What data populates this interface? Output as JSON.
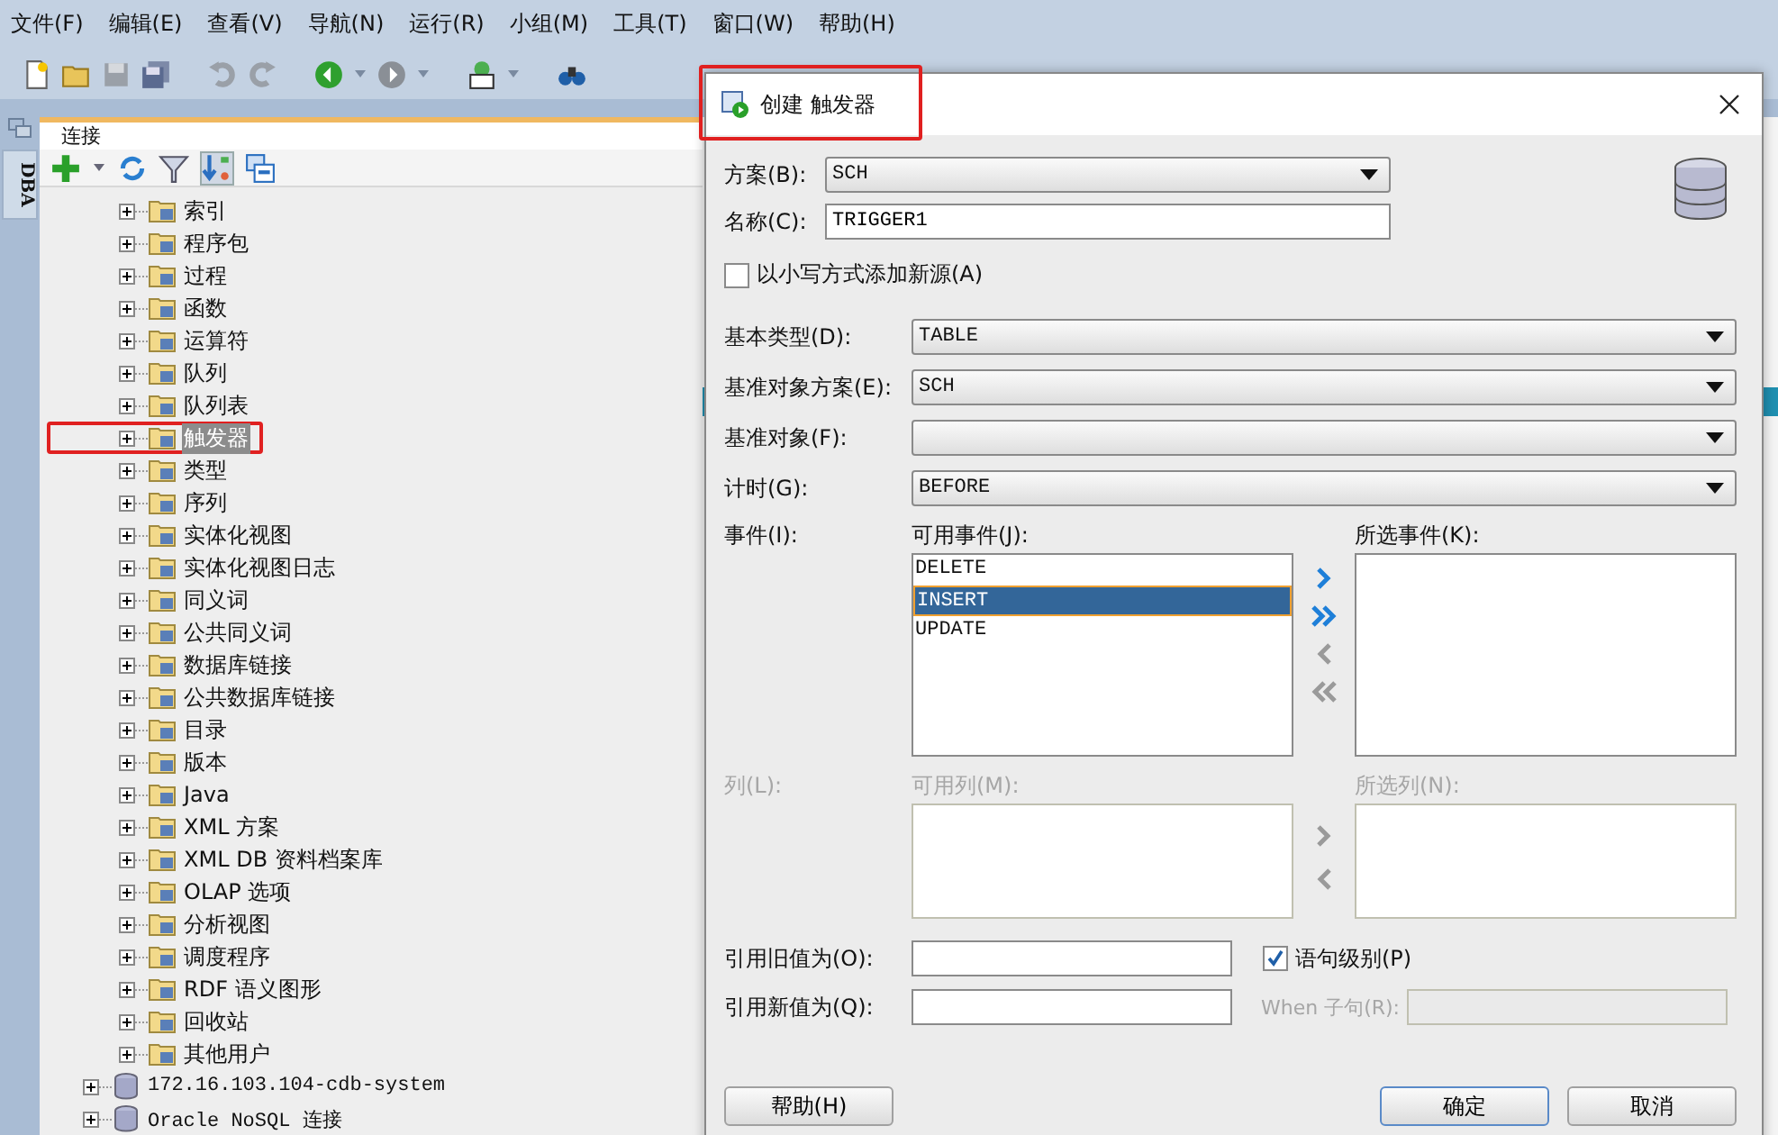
{
  "menu": [
    "文件(F)",
    "编辑(E)",
    "查看(V)",
    "导航(N)",
    "运行(R)",
    "小组(M)",
    "工具(T)",
    "窗口(W)",
    "帮助(H)"
  ],
  "side_tab": {
    "label": "DBA"
  },
  "connections_panel": {
    "title": "连接",
    "tree": [
      {
        "label": "索引",
        "selected": false
      },
      {
        "label": "程序包",
        "selected": false
      },
      {
        "label": "过程",
        "selected": false
      },
      {
        "label": "函数",
        "selected": false
      },
      {
        "label": "运算符",
        "selected": false
      },
      {
        "label": "队列",
        "selected": false
      },
      {
        "label": "队列表",
        "selected": false
      },
      {
        "label": "触发器",
        "selected": true
      },
      {
        "label": "类型",
        "selected": false
      },
      {
        "label": "序列",
        "selected": false
      },
      {
        "label": "实体化视图",
        "selected": false
      },
      {
        "label": "实体化视图日志",
        "selected": false
      },
      {
        "label": "同义词",
        "selected": false
      },
      {
        "label": "公共同义词",
        "selected": false
      },
      {
        "label": "数据库链接",
        "selected": false
      },
      {
        "label": "公共数据库链接",
        "selected": false
      },
      {
        "label": "目录",
        "selected": false
      },
      {
        "label": "版本",
        "selected": false
      },
      {
        "label": "Java",
        "selected": false
      },
      {
        "label": "XML 方案",
        "selected": false
      },
      {
        "label": "XML DB 资料档案库",
        "selected": false
      },
      {
        "label": "OLAP 选项",
        "selected": false
      },
      {
        "label": "分析视图",
        "selected": false
      },
      {
        "label": "调度程序",
        "selected": false
      },
      {
        "label": "RDF 语义图形",
        "selected": false
      },
      {
        "label": "回收站",
        "selected": false
      },
      {
        "label": "其他用户",
        "selected": false
      }
    ],
    "connections": [
      {
        "label": "172.16.103.104-cdb-system"
      },
      {
        "label": "Oracle NoSQL 连接"
      }
    ]
  },
  "dialog": {
    "title": "创建 触发器",
    "schema": {
      "label": "方案(B):",
      "value": "SCH"
    },
    "name": {
      "label": "名称(C):",
      "value": "TRIGGER1"
    },
    "lowercase": {
      "label": "以小写方式添加新源(A)",
      "checked": false
    },
    "base_rows": [
      {
        "label": "基本类型(D):",
        "value": "TABLE"
      },
      {
        "label": "基准对象方案(E):",
        "value": "SCH"
      },
      {
        "label": "基准对象(F):"
      },
      {
        "label": "计时(G):",
        "value": "BEFORE"
      }
    ],
    "events": {
      "label": "事件(I):",
      "disabled": false,
      "available_label": "可用事件(J):",
      "selected_label": "所选事件(K):",
      "available": [
        {
          "label": "DELETE",
          "selected": false
        },
        {
          "label": "INSERT",
          "selected": true
        },
        {
          "label": "UPDATE",
          "selected": false
        }
      ]
    },
    "columns": {
      "label": "列(L):",
      "disabled": true,
      "available_label": "可用列(M):",
      "selected_label": "所选列(N):"
    },
    "ref_old": {
      "label": "引用旧值为(O):"
    },
    "ref_new": {
      "label": "引用新值为(Q):"
    },
    "statement_level": {
      "label": "语句级别(P)",
      "checked": true
    },
    "when_clause": {
      "label": "When 子句(R):",
      "disabled": true
    },
    "buttons": {
      "help": "帮助(H)",
      "ok": "确定",
      "cancel": "取消"
    }
  }
}
